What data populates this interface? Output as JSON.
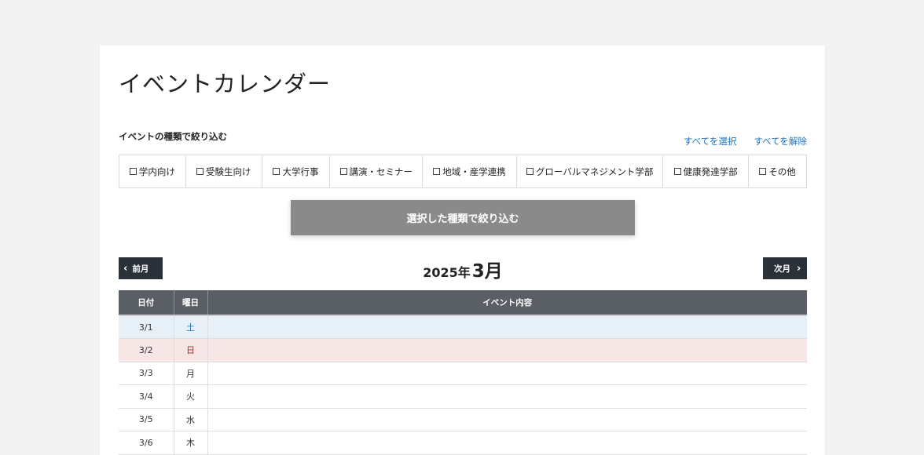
{
  "page": {
    "title": "イベントカレンダー"
  },
  "filter": {
    "heading": "イベントの種類で絞り込む",
    "select_all": "すべてを選択",
    "deselect_all": "すべてを解除",
    "options": [
      {
        "label": "学内向け",
        "checked": false
      },
      {
        "label": "受験生向け",
        "checked": false
      },
      {
        "label": "大学行事",
        "checked": false
      },
      {
        "label": "講演・セミナー",
        "checked": false
      },
      {
        "label": "地域・産学連携",
        "checked": false
      },
      {
        "label": "グローバルマネジメント学部",
        "checked": false
      },
      {
        "label": "健康発達学部",
        "checked": false
      },
      {
        "label": "その他",
        "checked": false
      }
    ],
    "apply_button": "選択した種類で絞り込む"
  },
  "month_nav": {
    "prev_label": "前月",
    "next_label": "次月",
    "year": "2025年",
    "month": "3月"
  },
  "calendar": {
    "headers": {
      "date": "日付",
      "day": "曜日",
      "content": "イベント内容"
    },
    "rows": [
      {
        "date": "3/1",
        "day": "土",
        "type": "sat",
        "content": ""
      },
      {
        "date": "3/2",
        "day": "日",
        "type": "sun",
        "content": ""
      },
      {
        "date": "3/3",
        "day": "月",
        "type": "weekday",
        "content": ""
      },
      {
        "date": "3/4",
        "day": "火",
        "type": "weekday",
        "content": ""
      },
      {
        "date": "3/5",
        "day": "水",
        "type": "weekday",
        "content": ""
      },
      {
        "date": "3/6",
        "day": "木",
        "type": "weekday",
        "content": ""
      }
    ]
  },
  "colors": {
    "accent_link": "#1f72b8",
    "nav_button": "#2b3138",
    "table_header": "#5a5f65",
    "saturday_bg": "#e8f0f7",
    "sunday_bg": "#f7e6e6",
    "apply_button": "#8a8a8a"
  }
}
